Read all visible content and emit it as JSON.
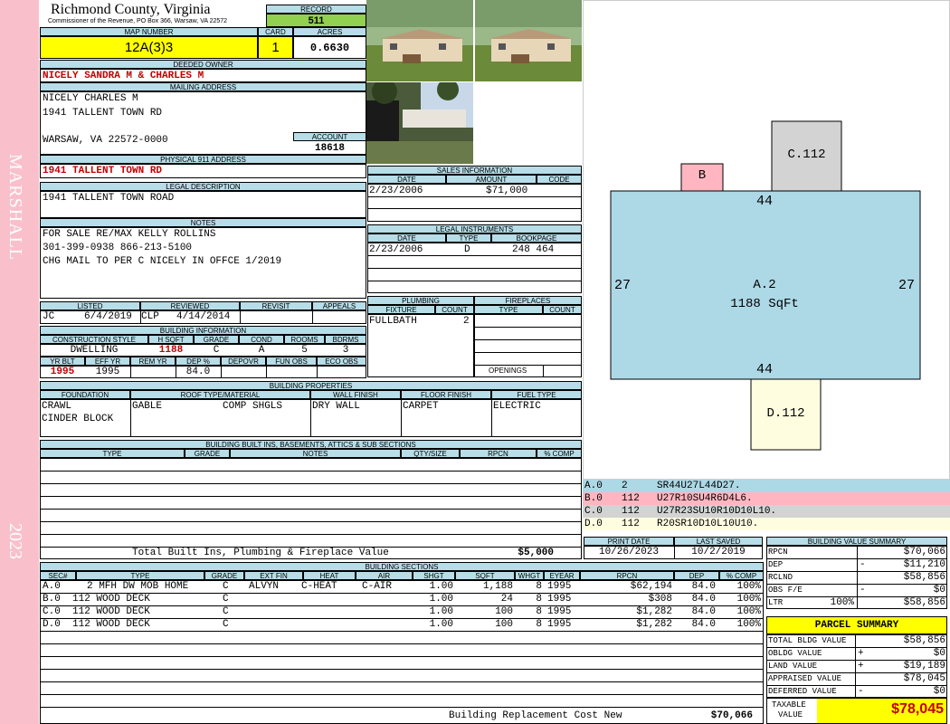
{
  "sidebar": {
    "name": "MARSHALL",
    "year": "2023"
  },
  "header": {
    "county": "Richmond County, Virginia",
    "commissioner": "Commissioner of the Revenue, PO Box 366, Warsaw, VA 22572",
    "record_label": "RECORD",
    "record": "511",
    "map_number_label": "MAP NUMBER",
    "map_number": "12A(3)3",
    "card_label": "CARD",
    "card": "1",
    "acres_label": "ACRES",
    "acres": "0.6630"
  },
  "owner": {
    "deeded_label": "DEEDED OWNER",
    "deeded": "NICELY SANDRA M & CHARLES M",
    "mailing_label": "MAILING ADDRESS",
    "mail1": "NICELY CHARLES M",
    "mail2": "1941 TALLENT TOWN RD",
    "mail3": "WARSAW, VA 22572-0000",
    "account_label": "ACCOUNT",
    "account": "18618",
    "physical_label": "PHYSICAL 911 ADDRESS",
    "physical": "1941 TALLENT TOWN RD",
    "legal_label": "LEGAL DESCRIPTION",
    "legal": "1941 TALLENT TOWN ROAD"
  },
  "notes": {
    "label": "NOTES",
    "line1": "FOR SALE RE/MAX KELLY ROLLINS",
    "line2": "301-399-0938 866-213-5100",
    "line3": "CHG MAIL TO PER C NICELY IN OFFCE 1/2019"
  },
  "listing": {
    "listed_label": "LISTED",
    "listed_by": "JC",
    "listed_date": "6/4/2019",
    "reviewed_label": "REVIEWED",
    "reviewed_by": "CLP",
    "reviewed_date": "4/14/2014",
    "revisit_label": "REVISIT",
    "appeals_label": "APPEALS"
  },
  "building_info": {
    "label": "BUILDING INFORMATION",
    "cols": [
      "CONSTRUCTION STYLE",
      "H SQFT",
      "GRADE",
      "COND",
      "ROOMS",
      "BDRMS"
    ],
    "vals": [
      "DWELLING",
      "1188",
      "C",
      "A",
      "5",
      "3"
    ],
    "cols2": [
      "YR BLT",
      "EFF YR",
      "REM YR",
      "DEP %",
      "DEPOVR",
      "FUN OBS",
      "ECO OBS"
    ],
    "vals2": [
      "1995",
      "1995",
      "",
      "84.0",
      "",
      "",
      ""
    ]
  },
  "sales": {
    "label": "SALES INFORMATION",
    "cols": [
      "DATE",
      "AMOUNT",
      "CODE"
    ],
    "row": [
      "2/23/2006",
      "$71,000",
      ""
    ]
  },
  "legal_instr": {
    "label": "LEGAL INSTRUMENTS",
    "cols": [
      "DATE",
      "TYPE",
      "BOOKPAGE"
    ],
    "row": [
      "2/23/2006",
      "D",
      "248 464"
    ]
  },
  "plumbing": {
    "label": "PLUMBING",
    "cols": [
      "FIXTURE",
      "COUNT"
    ],
    "row": [
      "FULLBATH",
      "2"
    ]
  },
  "fireplaces": {
    "label": "FIREPLACES",
    "cols": [
      "TYPE",
      "COUNT"
    ],
    "openings": "OPENINGS"
  },
  "properties": {
    "label": "BUILDING PROPERTIES",
    "cols": [
      "FOUNDATION",
      "ROOF TYPE/MATERIAL",
      "WALL FINISH",
      "FLOOR FINISH",
      "FUEL TYPE"
    ],
    "foundation1": "CRAWL",
    "foundation2": "CINDER BLOCK",
    "roof_type": "GABLE",
    "roof_mat": "COMP SHGLS",
    "wall": "DRY WALL",
    "floor": "CARPET",
    "fuel": "ELECTRIC"
  },
  "builtins": {
    "label": "BUILDING BUILT INS, BASEMENTS, ATTICS & SUB SECTIONS",
    "cols": [
      "TYPE",
      "GRADE",
      "NOTES",
      "QTY/SIZE",
      "RPCN",
      "% COMP"
    ],
    "total_label": "Total Built Ins, Plumbing & Fireplace Value",
    "total": "$5,000"
  },
  "print": {
    "print_label": "PRINT DATE",
    "print_date": "10/26/2023",
    "saved_label": "LAST SAVED",
    "saved_date": "10/2/2019"
  },
  "sketch": {
    "a_label": "A.2",
    "a_area": "1188 SqFt",
    "top": "44",
    "bottom": "44",
    "left": "27",
    "right": "27",
    "b": "B",
    "c": "C.112",
    "d": "D.112",
    "legend": [
      [
        "A.0",
        "2",
        "SR44U27L44D27."
      ],
      [
        "B.0",
        "112",
        "U27R10SU4R6D4L6."
      ],
      [
        "C.0",
        "112",
        "U27R23SU10R10D10L10."
      ],
      [
        "D.0",
        "112",
        "R20SR10D10L10U10."
      ]
    ]
  },
  "sections": {
    "label": "BUILDING SECTIONS",
    "cols": [
      "SEC#",
      "TYPE",
      "GRADE",
      "EXT FIN",
      "HEAT",
      "AIR",
      "SHGT",
      "SQFT",
      "WHGT",
      "EYEAR",
      "RPCN",
      "DEP",
      "% COMP"
    ],
    "rows": [
      [
        "A.0",
        "2 MFH DW MOB HOME",
        "C",
        "ALVYN",
        "C-HEAT",
        "C-AIR",
        "1.00",
        "1,188",
        "8",
        "1995",
        "$62,194",
        "84.0",
        "100%"
      ],
      [
        "B.0",
        "112 WOOD DECK",
        "C",
        "",
        "",
        "",
        "1.00",
        "24",
        "8",
        "1995",
        "$308",
        "84.0",
        "100%"
      ],
      [
        "C.0",
        "112 WOOD DECK",
        "C",
        "",
        "",
        "",
        "1.00",
        "100",
        "8",
        "1995",
        "$1,282",
        "84.0",
        "100%"
      ],
      [
        "D.0",
        "112 WOOD DECK",
        "C",
        "",
        "",
        "",
        "1.00",
        "100",
        "8",
        "1995",
        "$1,282",
        "84.0",
        "100%"
      ]
    ],
    "total_label": "Building Replacement Cost New",
    "total": "$70,066"
  },
  "value_summary": {
    "label": "BUILDING VALUE SUMMARY",
    "rpcn_l": "RPCN",
    "rpcn": "$70,066",
    "dep_l": "DEP",
    "dep_sign": "-",
    "dep": "$11,210",
    "rclnd_l": "RCLND",
    "rclnd": "$58,856",
    "obs_l": "OBS F/E",
    "obs_sign": "-",
    "obs": "$0",
    "ltr_l": "LTR",
    "ltr_pct": "100%",
    "ltr": "$58,856"
  },
  "parcel": {
    "label": "PARCEL SUMMARY",
    "bldg_l": "TOTAL BLDG VALUE",
    "bldg": "$58,856",
    "obldg_l": "OBLDG VALUE",
    "obldg_sign": "+",
    "obldg": "$0",
    "land_l": "LAND VALUE",
    "land_sign": "+",
    "land": "$19,189",
    "appr_l": "APPRAISED VALUE",
    "appr": "$78,045",
    "def_l": "DEFERRED VALUE",
    "def_sign": "-",
    "def": "$0",
    "tax_l1": "TAXABLE",
    "tax_l2": "VALUE",
    "tax": "$78,045"
  },
  "colors": {
    "header": "#b6dde8",
    "sidebar": "#f9c0cb",
    "yellow": "#ffff00",
    "record": "#92d050",
    "red": "#c00000",
    "sketch_main": "#add8e6",
    "sketch_b": "#ffb6c1",
    "sketch_c": "#d3d3d3",
    "sketch_d": "#fffde0"
  }
}
